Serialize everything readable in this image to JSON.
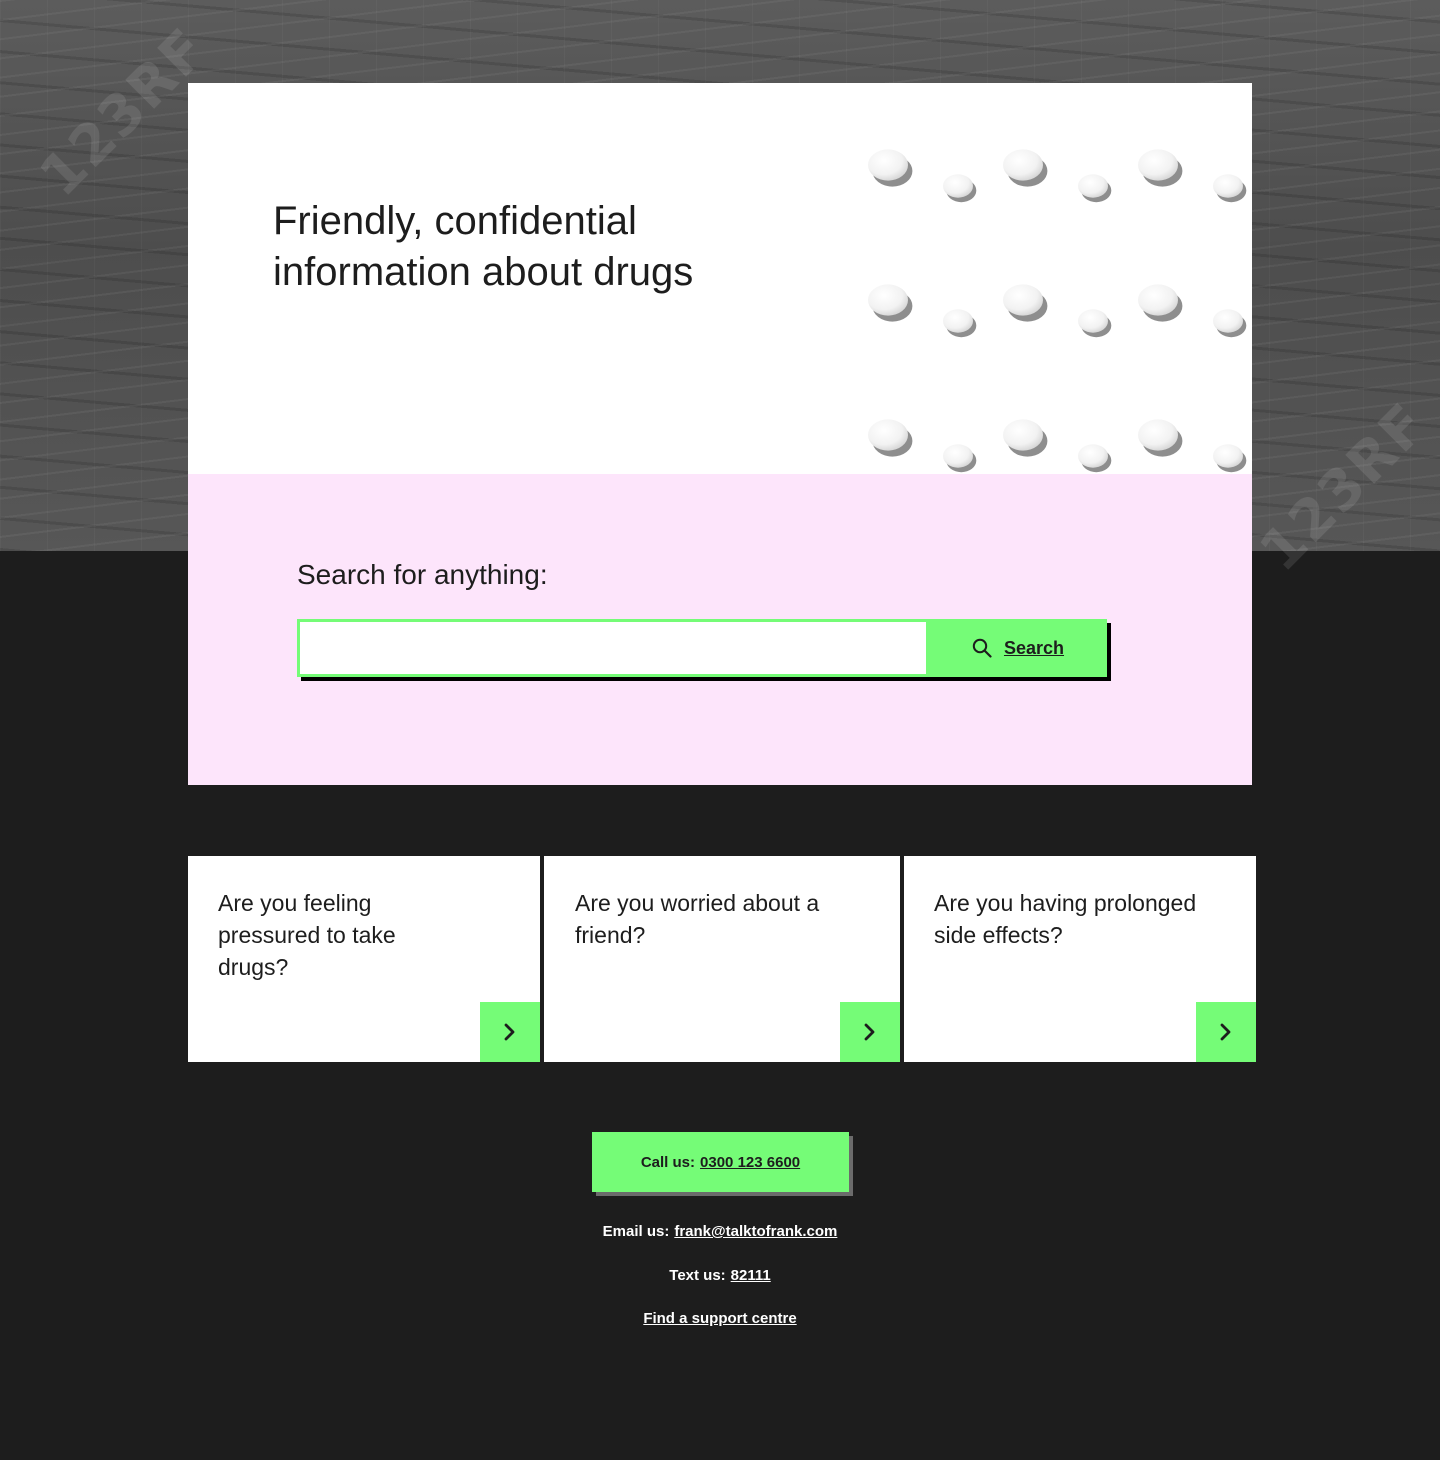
{
  "background": {
    "watermark_text": "123RF"
  },
  "hero": {
    "title_line1": "Friendly, confidential",
    "title_line2": "information about drugs"
  },
  "search": {
    "label": "Search for anything:",
    "input_value": "",
    "button_label": "Search"
  },
  "cards": [
    {
      "text": "Are you feeling pressured to take drugs?"
    },
    {
      "text": "Are you worried about a friend?"
    },
    {
      "text": "Are you having prolonged side effects?"
    }
  ],
  "contact": {
    "call_prefix": "Call us:",
    "call_number": "0300 123 6600",
    "email_prefix": "Email us:",
    "email": "frank@talktofrank.com",
    "text_prefix": "Text us:",
    "text_number": "82111",
    "support_link": "Find a support centre"
  },
  "colors": {
    "accent_green": "#75fc77",
    "search_panel_pink": "#fde5fb",
    "page_dark": "#1d1d1d",
    "hero_white": "#ffffff"
  },
  "icons": [
    "search-icon",
    "chevron-right-icon"
  ]
}
